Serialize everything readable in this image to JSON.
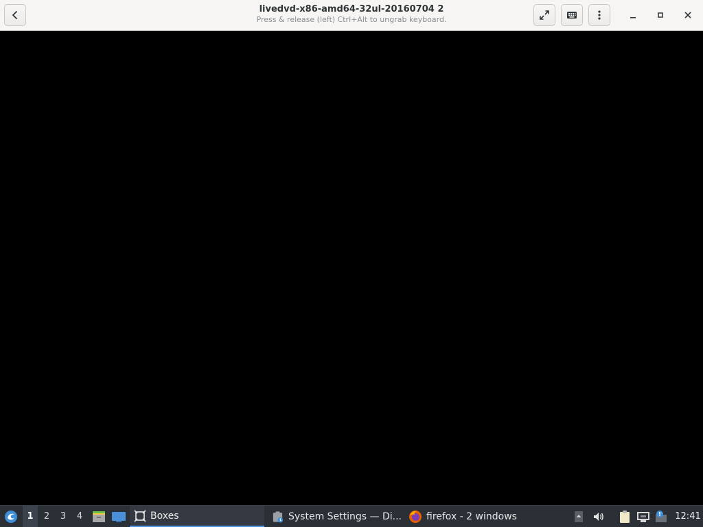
{
  "window": {
    "title": "livedvd-x86-amd64-32ul-20160704 2",
    "subtitle": "Press & release (left) Ctrl+Alt to ungrab keyboard."
  },
  "header_buttons": {
    "back_icon": "chevron-left-icon",
    "fullscreen_icon": "fullscreen-icon",
    "keyboard_icon": "keyboard-icon",
    "menu_icon": "vertical-dots-icon",
    "minimize_icon": "minimize-icon",
    "maximize_icon": "maximize-icon",
    "close_icon": "close-icon"
  },
  "taskbar": {
    "workspaces": [
      "1",
      "2",
      "3",
      "4"
    ],
    "active_workspace": "1",
    "tasks": [
      {
        "label": "Boxes",
        "icon": "boxes-icon",
        "active": true
      },
      {
        "label": "System Settings — Di...",
        "icon": "system-settings-icon",
        "active": false
      },
      {
        "label": "firefox - 2 windows",
        "icon": "firefox-icon",
        "active": false
      }
    ],
    "clock": "12:41"
  },
  "colors": {
    "header_bg": "#f6f5f4",
    "vm_bg": "#000000",
    "taskbar_bg": "#2b2f36",
    "accent": "#5294e2"
  }
}
